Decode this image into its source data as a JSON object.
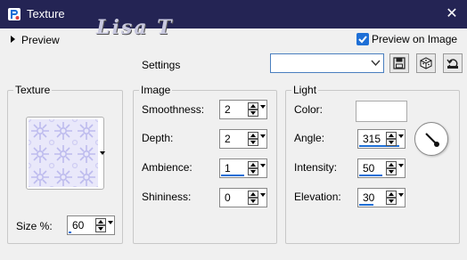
{
  "window": {
    "title": "Texture",
    "watermark": "Lisa T",
    "close_glyph": "✕"
  },
  "preview": {
    "toggle_label": "Preview",
    "preview_on_image_label": "Preview on Image",
    "preview_on_image_checked": true
  },
  "settings": {
    "label": "Settings",
    "preset_value": "",
    "buttons": [
      "save-preset-icon",
      "randomize-icon",
      "reset-icon"
    ]
  },
  "texture": {
    "group_title": "Texture",
    "size_label": "Size %:",
    "size_value": "60",
    "size_fraction": 0.06
  },
  "image": {
    "group_title": "Image",
    "fields": [
      {
        "label": "Smoothness:",
        "value": "2",
        "fraction": 0.0
      },
      {
        "label": "Depth:",
        "value": "2",
        "fraction": 0.0
      },
      {
        "label": "Ambience:",
        "value": "1",
        "fraction": 0.5
      },
      {
        "label": "Shininess:",
        "value": "0",
        "fraction": 0.0
      }
    ]
  },
  "light": {
    "group_title": "Light",
    "color_label": "Color:",
    "color_value": "#ffffff",
    "fields": [
      {
        "label": "Angle:",
        "value": "315",
        "fraction": 0.875
      },
      {
        "label": "Intensity:",
        "value": "50",
        "fraction": 0.5
      },
      {
        "label": "Elevation:",
        "value": "30",
        "fraction": 0.33
      }
    ]
  },
  "colors": {
    "titlebar": "#242454",
    "accent": "#1e6fd6",
    "texture_pattern": "#c8c6ef"
  }
}
